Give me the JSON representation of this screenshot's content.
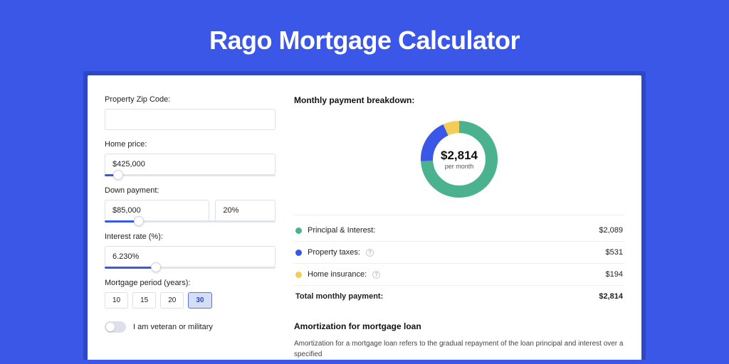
{
  "title": "Rago Mortgage Calculator",
  "form": {
    "zip": {
      "label": "Property Zip Code:",
      "value": ""
    },
    "home_price": {
      "label": "Home price:",
      "value": "$425,000",
      "slider_pct": 8
    },
    "down_payment": {
      "label": "Down payment:",
      "amount": "$85,000",
      "percent": "20%",
      "slider_pct": 20
    },
    "interest": {
      "label": "Interest rate (%):",
      "value": "6.230%",
      "slider_pct": 30
    },
    "period": {
      "label": "Mortgage period (years):",
      "options": [
        "10",
        "15",
        "20",
        "30"
      ],
      "selected": "30"
    },
    "veteran": {
      "label": "I am veteran or military",
      "on": false
    }
  },
  "breakdown": {
    "title": "Monthly payment breakdown:",
    "center_amount": "$2,814",
    "center_sub": "per month",
    "items": [
      {
        "label": "Principal & Interest:",
        "value": "$2,089",
        "color": "#4bb28f",
        "info": false,
        "pct": 74
      },
      {
        "label": "Property taxes:",
        "value": "$531",
        "color": "#3a57e8",
        "info": true,
        "pct": 19
      },
      {
        "label": "Home insurance:",
        "value": "$194",
        "color": "#f3cd55",
        "info": true,
        "pct": 7
      }
    ],
    "total_label": "Total monthly payment:",
    "total_value": "$2,814"
  },
  "amortization": {
    "title": "Amortization for mortgage loan",
    "text": "Amortization for a mortgage loan refers to the gradual repayment of the loan principal and interest over a specified"
  },
  "chart_data": {
    "type": "pie",
    "title": "Monthly payment breakdown",
    "series": [
      {
        "name": "Principal & Interest",
        "value": 2089,
        "color": "#4bb28f"
      },
      {
        "name": "Property taxes",
        "value": 531,
        "color": "#3a57e8"
      },
      {
        "name": "Home insurance",
        "value": 194,
        "color": "#f3cd55"
      }
    ],
    "total": 2814,
    "center_label": "$2,814 per month"
  }
}
